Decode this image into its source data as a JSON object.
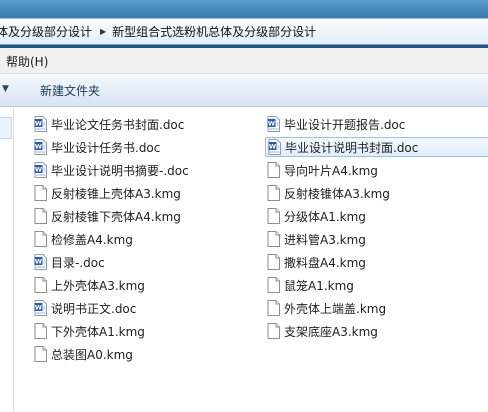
{
  "address_bar": {
    "crumbs": [
      "体及分级部分设计",
      "新型组合式选粉机总体及分级部分设计"
    ]
  },
  "menu": {
    "help_label": "帮助(H)"
  },
  "toolbar": {
    "new_folder_label": "新建文件夹"
  },
  "files": [
    {
      "name": "毕业论文任务书封面.doc",
      "type": "word"
    },
    {
      "name": "毕业设计任务书.doc",
      "type": "word"
    },
    {
      "name": "毕业设计说明书摘要-.doc",
      "type": "word"
    },
    {
      "name": "反射棱锥上壳体A3.kmg",
      "type": "kmg"
    },
    {
      "name": "反射棱锥下壳体A4.kmg",
      "type": "kmg"
    },
    {
      "name": "检修盖A4.kmg",
      "type": "kmg"
    },
    {
      "name": "目录-.doc",
      "type": "word"
    },
    {
      "name": "上外壳体A3.kmg",
      "type": "kmg"
    },
    {
      "name": "说明书正文.doc",
      "type": "word"
    },
    {
      "name": "下外壳体A1.kmg",
      "type": "kmg"
    },
    {
      "name": "总装图A0.kmg",
      "type": "kmg"
    },
    {
      "name": "毕业设计开题报告.doc",
      "type": "word"
    },
    {
      "name": "毕业设计说明书封面.doc",
      "type": "word",
      "selected": true
    },
    {
      "name": "导向叶片A4.kmg",
      "type": "kmg"
    },
    {
      "name": "反射棱锥体A3.kmg",
      "type": "kmg"
    },
    {
      "name": "分级体A1.kmg",
      "type": "kmg"
    },
    {
      "name": "进料管A3.kmg",
      "type": "kmg"
    },
    {
      "name": "撒料盘A4.kmg",
      "type": "kmg"
    },
    {
      "name": "鼠笼A1.kmg",
      "type": "kmg"
    },
    {
      "name": "外壳体上端盖.kmg",
      "type": "kmg"
    },
    {
      "name": "支架底座A3.kmg",
      "type": "kmg"
    }
  ]
}
